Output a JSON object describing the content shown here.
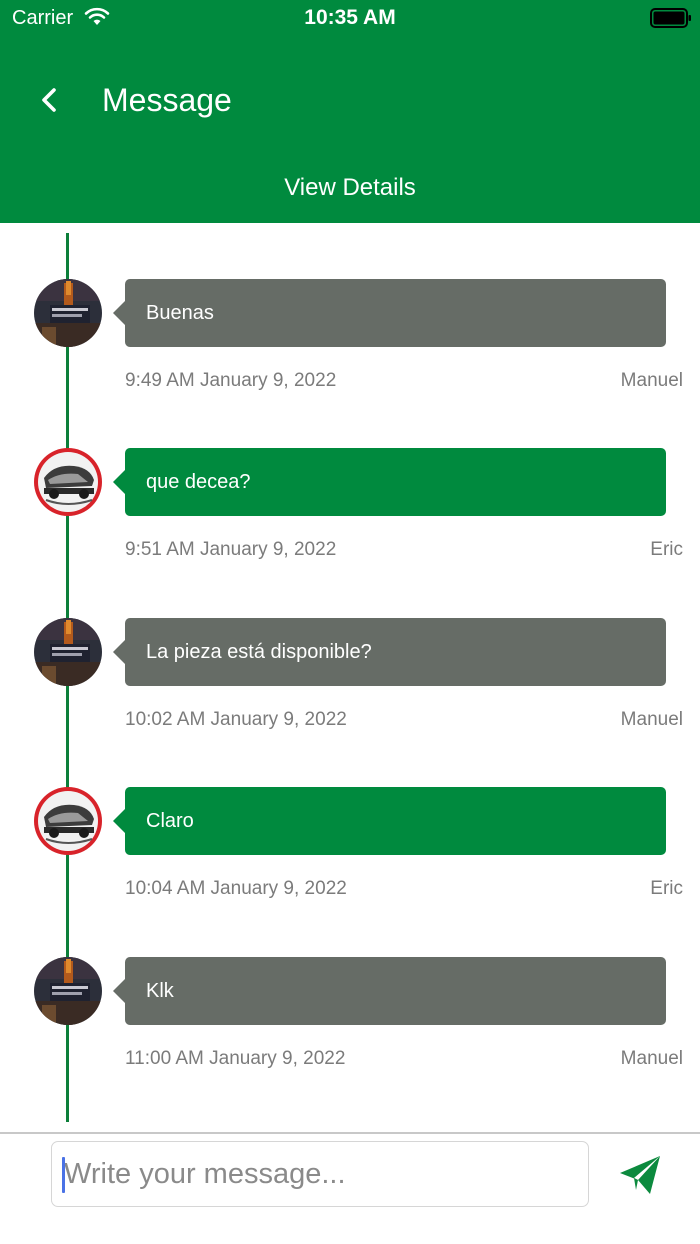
{
  "status_bar": {
    "carrier": "Carrier",
    "time": "10:35 AM"
  },
  "header": {
    "title": "Message",
    "view_details": "View Details"
  },
  "colors": {
    "brand_green": "#008a3e",
    "bubble_gray": "#666c66"
  },
  "messages": [
    {
      "text": "Buenas",
      "timestamp": "9:49 AM January 9, 2022",
      "sender": "Manuel",
      "style": "gray",
      "avatar": "manuel-avatar"
    },
    {
      "text": "que decea?",
      "timestamp": "9:51 AM January 9, 2022",
      "sender": "Eric",
      "style": "green",
      "avatar": "eric-avatar"
    },
    {
      "text": "La pieza está disponible?",
      "timestamp": "10:02 AM January 9, 2022",
      "sender": "Manuel",
      "style": "gray",
      "avatar": "manuel-avatar"
    },
    {
      "text": "Claro",
      "timestamp": "10:04 AM January 9, 2022",
      "sender": "Eric",
      "style": "green",
      "avatar": "eric-avatar"
    },
    {
      "text": "Klk",
      "timestamp": "11:00 AM January 9, 2022",
      "sender": "Manuel",
      "style": "gray",
      "avatar": "manuel-avatar"
    }
  ],
  "composer": {
    "placeholder": "Write your message...",
    "value": ""
  }
}
